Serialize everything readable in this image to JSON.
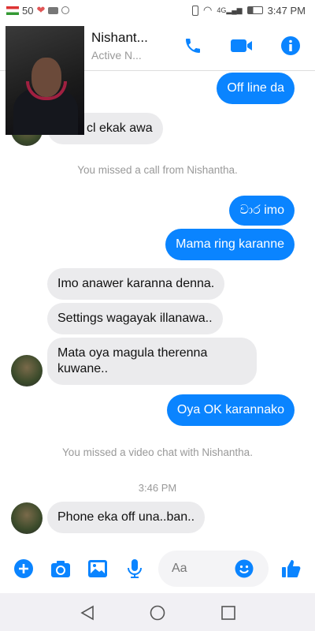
{
  "status_bar": {
    "left_text": "50",
    "time": "3:47 PM",
    "network": "4G"
  },
  "header": {
    "contact_name": "Nishant...",
    "status": "Active N..."
  },
  "messages": [
    {
      "dir": "out",
      "text": "Off line da"
    },
    {
      "dir": "in",
      "text": "cl ekak awa"
    },
    {
      "dir": "sys",
      "text": "You missed a call from Nishantha."
    },
    {
      "dir": "out",
      "text": "වාර imo"
    },
    {
      "dir": "out",
      "text": "Mama ring karanne"
    },
    {
      "dir": "in",
      "text": "Imo anawer karanna denna."
    },
    {
      "dir": "in",
      "text": "Settings wagayak illanawa.."
    },
    {
      "dir": "in",
      "text": "Mata oya magula therenna kuwane.."
    },
    {
      "dir": "out",
      "text": "Oya OK karannako"
    },
    {
      "dir": "sys",
      "text": "You missed a video chat with Nishantha."
    },
    {
      "dir": "time",
      "text": "3:46 PM"
    },
    {
      "dir": "in",
      "text": "Phone eka off una..ban.."
    }
  ],
  "composer": {
    "placeholder": "Aa"
  },
  "colors": {
    "accent": "#0a84ff",
    "incoming": "#ebebed"
  }
}
